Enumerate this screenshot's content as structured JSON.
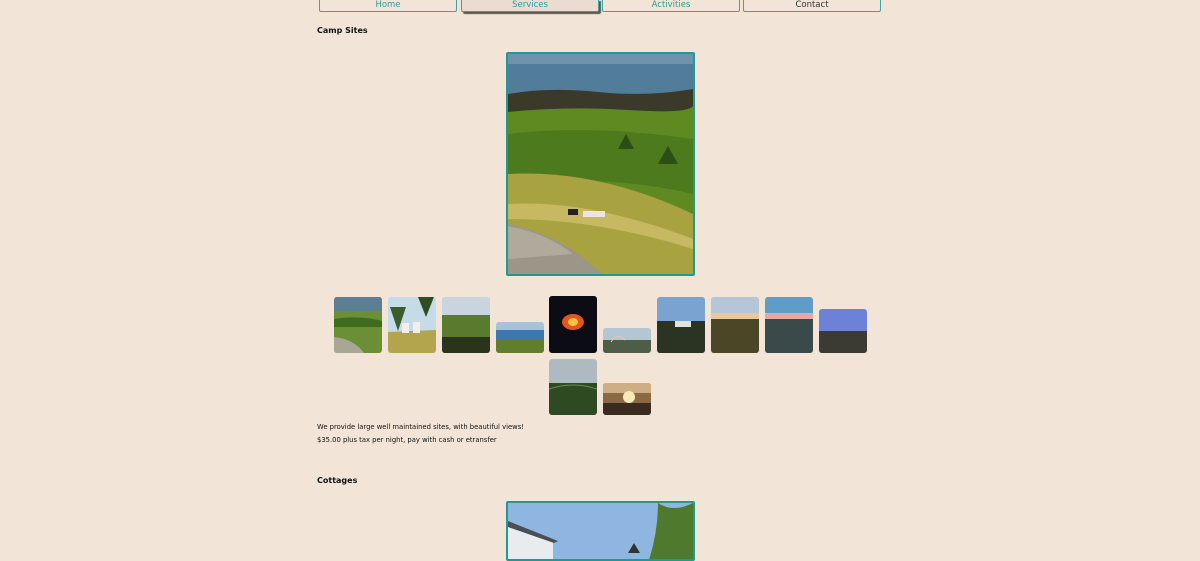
{
  "nav": {
    "items": [
      {
        "label": "Home",
        "state": "normal"
      },
      {
        "label": "Services",
        "state": "active"
      },
      {
        "label": "Activities",
        "state": "normal"
      },
      {
        "label": "Contact",
        "state": "normal"
      }
    ]
  },
  "camp_sites": {
    "title": "Camp Sites",
    "description": "We provide large well maintained sites, with beautiful views!",
    "price": "$35.00 plus tax per night, pay with cash or etransfer",
    "thumbnail_count": 12
  },
  "cottages": {
    "title": "Cottages"
  },
  "colors": {
    "background": "#f2e5d7",
    "accent": "#1f9a93",
    "nav_text": "#2a9d96"
  }
}
